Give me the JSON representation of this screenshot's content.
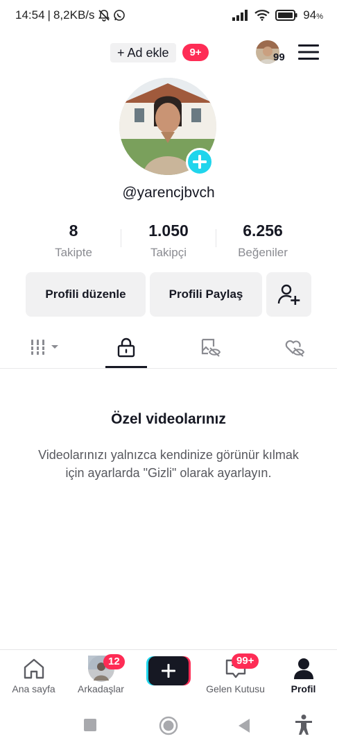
{
  "status_bar": {
    "time": "14:54",
    "separator": "|",
    "speed": "8,2KB/s",
    "battery_pct": "94",
    "battery_unit": "%"
  },
  "header": {
    "add_account_label": "+ Ad ekle",
    "add_account_badge": "9+",
    "avatar_count": "99",
    "menu_icon": "hamburger-menu-icon"
  },
  "profile": {
    "username": "@yarencjbvch",
    "stats": [
      {
        "value": "8",
        "label": "Takipte"
      },
      {
        "value": "1.050",
        "label": "Takipçi"
      },
      {
        "value": "6.256",
        "label": "Beğeniler"
      }
    ],
    "buttons": {
      "edit": "Profili düzenle",
      "share": "Profili Paylaş"
    }
  },
  "tabs": [
    {
      "icon": "grid-icon",
      "active": false
    },
    {
      "icon": "lock-icon",
      "active": true
    },
    {
      "icon": "tag-hidden-icon",
      "active": false
    },
    {
      "icon": "liked-hidden-icon",
      "active": false
    }
  ],
  "empty_state": {
    "title": "Özel videolarınız",
    "description": "Videolarınızı yalnızca kendinize görünür kılmak için ayarlarda \"Gizli\" olarak ayarlayın."
  },
  "bottom_nav": [
    {
      "label": "Ana sayfa",
      "icon": "home-icon"
    },
    {
      "label": "Arkadaşlar",
      "icon": "friends-avatar-icon",
      "badge": "12"
    },
    {
      "label": "",
      "icon": "create-icon"
    },
    {
      "label": "Gelen Kutusu",
      "icon": "inbox-icon",
      "badge": "99+"
    },
    {
      "label": "Profil",
      "icon": "profile-icon",
      "active": true
    }
  ],
  "colors": {
    "accent": "#fe2c55",
    "cyan": "#20d5ec",
    "text": "#161823",
    "muted": "#8a8b91"
  }
}
